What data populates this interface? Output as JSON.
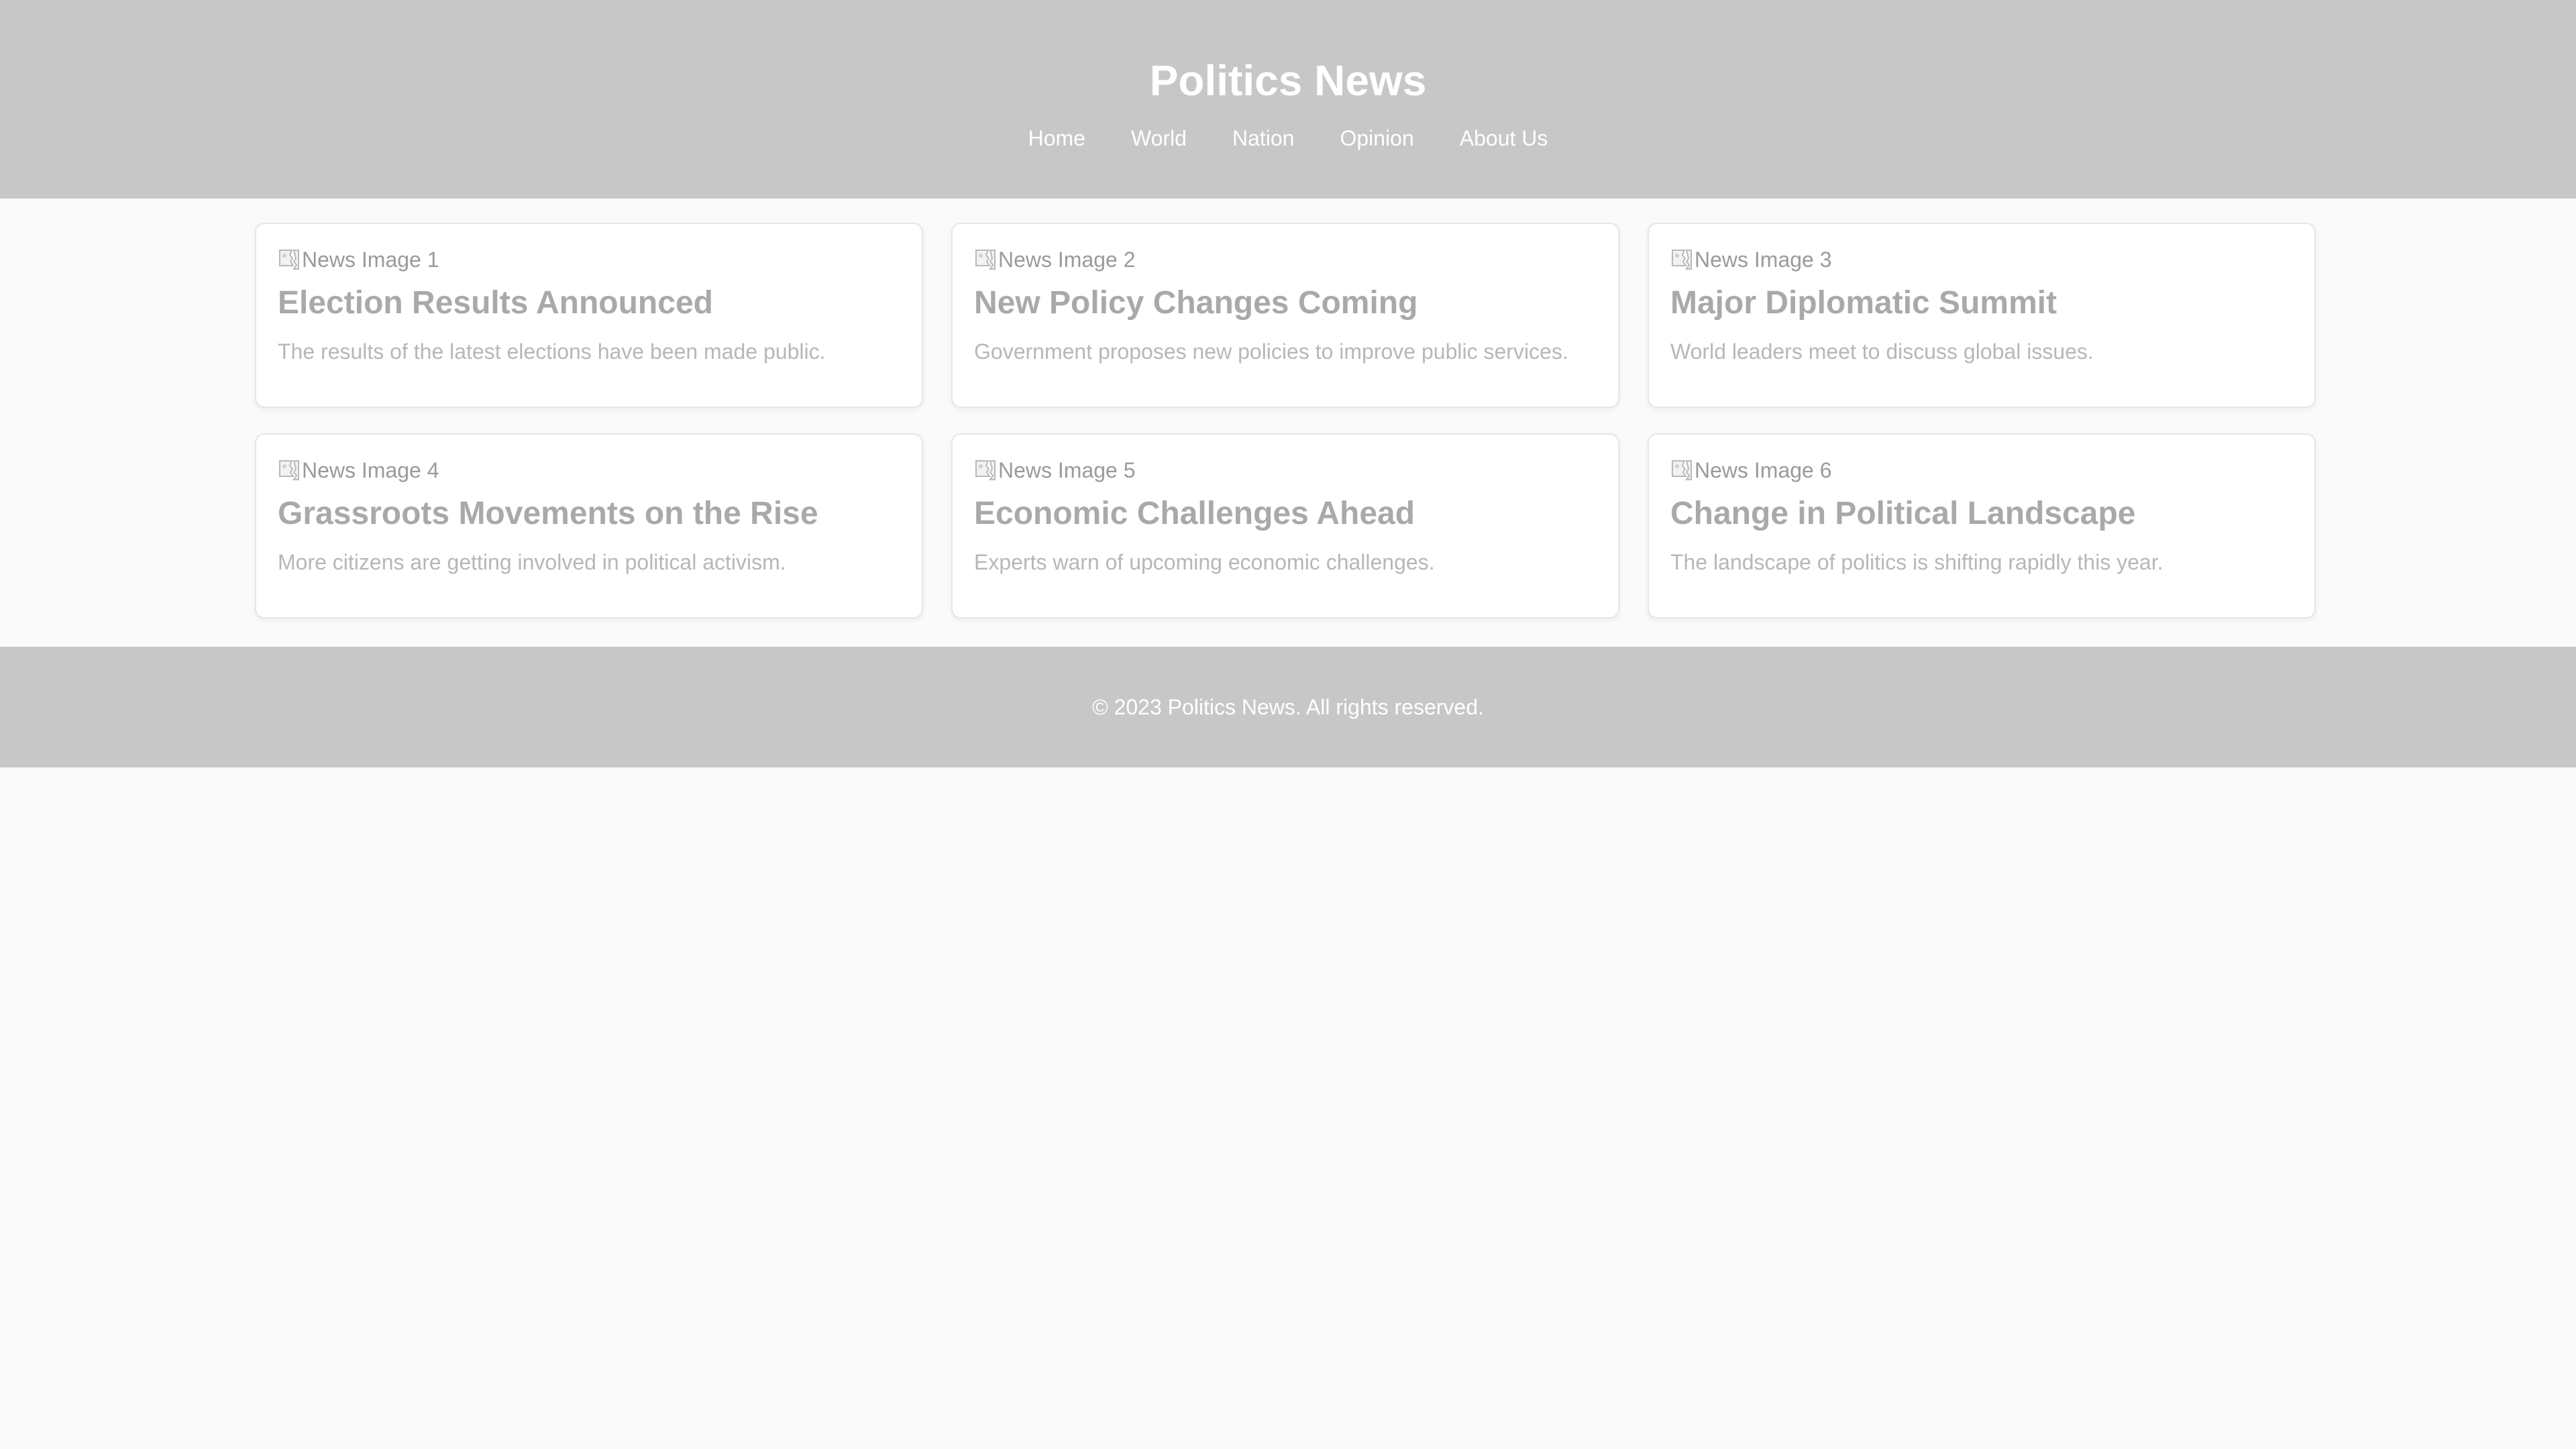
{
  "header": {
    "title": "Politics News",
    "nav": [
      "Home",
      "World",
      "Nation",
      "Opinion",
      "About Us"
    ]
  },
  "articles": [
    {
      "image_alt": "News Image 1",
      "title": "Election Results Announced",
      "description": "The results of the latest elections have been made public."
    },
    {
      "image_alt": "News Image 2",
      "title": "New Policy Changes Coming",
      "description": "Government proposes new policies to improve public services."
    },
    {
      "image_alt": "News Image 3",
      "title": "Major Diplomatic Summit",
      "description": "World leaders meet to discuss global issues."
    },
    {
      "image_alt": "News Image 4",
      "title": "Grassroots Movements on the Rise",
      "description": "More citizens are getting involved in political activism."
    },
    {
      "image_alt": "News Image 5",
      "title": "Economic Challenges Ahead",
      "description": "Experts warn of upcoming economic challenges."
    },
    {
      "image_alt": "News Image 6",
      "title": "Change in Political Landscape",
      "description": "The landscape of politics is shifting rapidly this year."
    }
  ],
  "footer": {
    "text": "© 2023 Politics News. All rights reserved."
  },
  "icons": {
    "article_image": "broken-image-icon"
  },
  "colors": {
    "header_bg": "#c7c7c7",
    "page_bg": "#fafafa",
    "title_text": "#a9a9a9"
  }
}
